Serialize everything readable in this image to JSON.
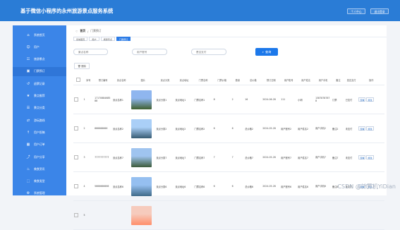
{
  "header": {
    "title": "基于微信小程序的永州旅游景点服务系统",
    "personal_center": "个人中心",
    "logout": "退出登录"
  },
  "sidebar": {
    "items": [
      {
        "label": "系统首页",
        "icon": "home-icon",
        "active": false
      },
      {
        "label": "用户",
        "icon": "user-icon",
        "active": false
      },
      {
        "label": "旅游景点",
        "icon": "list-icon",
        "active": false
      },
      {
        "label": "门票预订",
        "icon": "ticket-icon",
        "active": true
      },
      {
        "label": "退票记录",
        "icon": "refund-icon",
        "active": false
      },
      {
        "label": "景点推荐",
        "icon": "recommend-icon",
        "active": false
      },
      {
        "label": "景点分类",
        "icon": "category-icon",
        "active": false
      },
      {
        "label": "游玩路线",
        "icon": "route-icon",
        "active": false
      },
      {
        "label": "用户投稿",
        "icon": "upload-icon",
        "active": false
      },
      {
        "label": "用户订单",
        "icon": "order-icon",
        "active": false
      },
      {
        "label": "用户分享",
        "icon": "share-icon",
        "active": false
      },
      {
        "label": "美食资讯",
        "icon": "food-icon",
        "active": false
      },
      {
        "label": "美食类型",
        "icon": "type-icon",
        "active": false
      },
      {
        "label": "系统管理",
        "icon": "settings-icon",
        "active": false
      }
    ]
  },
  "breadcrumb": {
    "home": "首页",
    "current": "门票预订"
  },
  "tabs": [
    {
      "label": "系统首页",
      "active": false
    },
    {
      "label": "用户",
      "active": false
    },
    {
      "label": "旅游景点",
      "active": false
    },
    {
      "label": "门票预订",
      "active": true
    }
  ],
  "search": {
    "field1_placeholder": "景点名称",
    "field2_placeholder": "用户账号",
    "field3_placeholder": "是否支付",
    "query_label": "查询"
  },
  "toolbar": {
    "delete_label": "删除"
  },
  "table": {
    "columns": [
      "序号",
      "预订编号",
      "景点名称",
      "图片",
      "景点分类",
      "景点地址",
      "门票名称",
      "门票价格",
      "数量",
      "总价格",
      "预订日期",
      "用户账号",
      "用户姓名",
      "用户手机",
      "备注",
      "是否支付",
      "操作"
    ],
    "rows": [
      {
        "index": "1",
        "order_no": "1717068468588",
        "name": "景点名称1",
        "category": "景点分类1",
        "address": "景点地址1",
        "ticket": "门票名称1",
        "price": "8",
        "qty": "2",
        "total": "16",
        "date": "2024-06-28",
        "account": "111",
        "username": "小明",
        "phone": "13878787878",
        "note": "订票",
        "paid": "已支付",
        "action1": "查看",
        "action2": "修改",
        "img_top": "#8fb6ef",
        "img_bottom": "#3f5f2f"
      },
      {
        "index": "2",
        "order_no": "666666666",
        "name": "景点名称2",
        "category": "景点分类2",
        "address": "景点地址2",
        "ticket": "门票名称2",
        "price": "6",
        "qty": "6",
        "total": "总价格2",
        "date": "2024-05-28",
        "account": "用户账号2",
        "username": "用户姓名2",
        "phone": "用户手机2",
        "note": "备注2",
        "paid": "未支付",
        "action1": "查看",
        "action2": "修改",
        "img_top": "#aacff7",
        "img_bottom": "#375c73"
      },
      {
        "index": "3",
        "order_no": "7777777777",
        "name": "景点名称7",
        "category": "景点分类7",
        "address": "景点地址7",
        "ticket": "门票名称7",
        "price": "7",
        "qty": "7",
        "total": "总价格7",
        "date": "2024-05-28",
        "account": "用户账号7",
        "username": "用户姓名7",
        "phone": "用户手机7",
        "note": "备注7",
        "paid": "未支付",
        "action1": "查看",
        "action2": "修改",
        "img_top": "#9fc4ef",
        "img_bottom": "#3c5b3a"
      },
      {
        "index": "4",
        "order_no": "5666666666",
        "name": "景点名称6",
        "category": "景点分类6",
        "address": "景点地址6",
        "ticket": "门票名称6",
        "price": "6",
        "qty": "6",
        "total": "总价格6",
        "date": "2024-05-28",
        "account": "用户账号6",
        "username": "用户姓名6",
        "phone": "用户手机6",
        "note": "备注6",
        "paid": "未支付",
        "action1": "查看",
        "action2": "修改",
        "img_top": "#95bff0",
        "img_bottom": "#406b88"
      },
      {
        "index": "5",
        "order_no": "",
        "name": "",
        "category": "",
        "address": "",
        "ticket": "",
        "price": "",
        "qty": "",
        "total": "",
        "date": "",
        "account": "",
        "username": "",
        "phone": "",
        "note": "",
        "paid": "",
        "action1": "",
        "action2": "",
        "img_top": "#f6cbbd",
        "img_bottom": "#ff8e6a"
      }
    ]
  },
  "watermark": "CSDN @计算机YiDian",
  "colors": {
    "accent": "#2a7cd6",
    "sidebar": "#3b85e8",
    "button": "#1c78ea"
  }
}
